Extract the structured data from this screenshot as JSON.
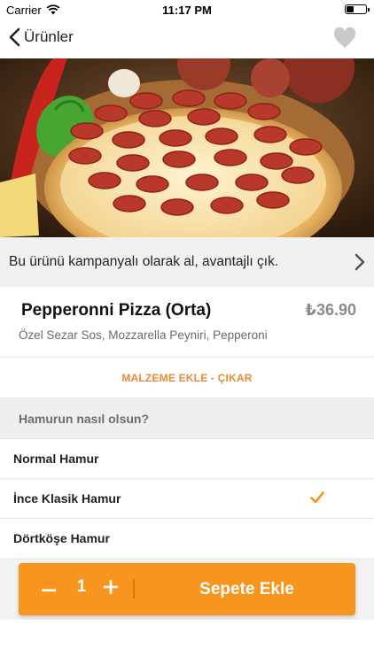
{
  "status_bar": {
    "carrier": "Carrier",
    "time": "11:17 PM",
    "battery_level": 0.4
  },
  "nav": {
    "back_label": "Ürünler",
    "back_icon": "chevron-left-icon",
    "favorite_icon": "heart-icon"
  },
  "campaign": {
    "text": "Bu ürünü kampanyalı olarak al, avantajlı çık.",
    "icon": "chevron-right-icon"
  },
  "product": {
    "name": "Pepperonni Pizza (Orta)",
    "price": "₺36.90",
    "description": "Özel Sezar Sos, Mozzarella Peyniri, Pepperoni"
  },
  "ingredients_button": "MALZEME EKLE - ÇIKAR",
  "dough_section": {
    "title": "Hamurun nasıl olsun?",
    "options": [
      {
        "label": "Normal Hamur",
        "selected": false
      },
      {
        "label": "İnce Klasik Hamur",
        "selected": true
      },
      {
        "label": "Dörtköşe Hamur",
        "selected": false
      }
    ]
  },
  "cart": {
    "quantity": "1",
    "add_label": "Sepete Ekle",
    "accent_color": "#f7951e"
  },
  "colors": {
    "accent": "#f7951e",
    "link_orange": "#ea8a36",
    "price_gray": "#8c8c8c"
  }
}
